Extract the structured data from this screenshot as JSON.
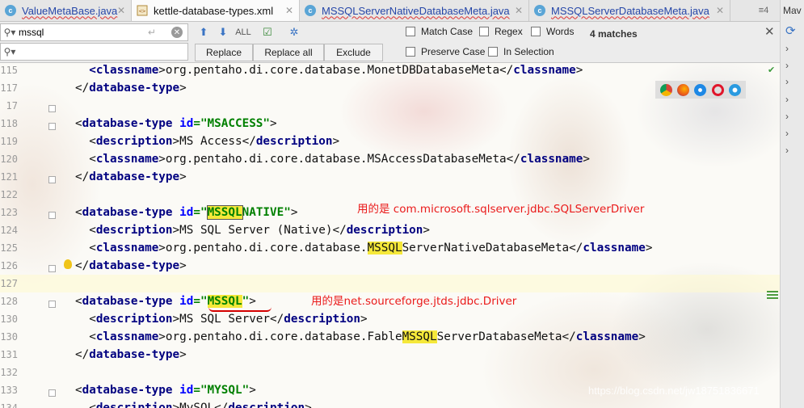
{
  "tabs": [
    {
      "label": "ValueMetaBase.java",
      "icon": "java-class-icon",
      "active": false
    },
    {
      "label": "kettle-database-types.xml",
      "icon": "xml-file-icon",
      "active": true
    },
    {
      "label": "MSSQLServerNativeDatabaseMeta.java",
      "icon": "java-class-icon",
      "active": false
    },
    {
      "label": "MSSQLServerDatabaseMeta.java",
      "icon": "java-class-icon",
      "active": false
    }
  ],
  "tab_overflow": "≡4",
  "right_panel_tab": "Mav",
  "find": {
    "search_value": "mssql",
    "replace_value": "",
    "buttons": {
      "replace": "Replace",
      "replace_all": "Replace all",
      "exclude": "Exclude"
    },
    "options": {
      "match_case": "Match Case",
      "regex": "Regex",
      "words": "Words",
      "preserve_case": "Preserve Case",
      "in_selection": "In Selection"
    },
    "matches": "4 matches"
  },
  "lines": [
    {
      "n": "115",
      "code": [
        {
          "t": "  <",
          "c": "tg"
        },
        {
          "t": "classname",
          "c": "tg"
        },
        {
          "t": ">org.pentaho.di.core.database.MonetDBDatabaseMeta</",
          "c": ""
        },
        {
          "t": "classname",
          "c": "tg"
        },
        {
          "t": ">",
          "c": ""
        }
      ]
    },
    {
      "n": "117",
      "code": [
        {
          "t": "</",
          "c": ""
        },
        {
          "t": "database-type",
          "c": "tg"
        },
        {
          "t": ">",
          "c": ""
        }
      ]
    },
    {
      "n": "17",
      "code": []
    },
    {
      "n": "118",
      "code": [
        {
          "t": "<",
          "c": ""
        },
        {
          "t": "database-type",
          "c": "tg"
        },
        {
          "t": " ",
          "c": ""
        },
        {
          "t": "id",
          "c": "at"
        },
        {
          "t": "=\"MSACCESS\"",
          "c": "av"
        },
        {
          "t": ">",
          "c": ""
        }
      ]
    },
    {
      "n": "119",
      "code": [
        {
          "t": "  <",
          "c": ""
        },
        {
          "t": "description",
          "c": "tg"
        },
        {
          "t": ">MS Access</",
          "c": ""
        },
        {
          "t": "description",
          "c": "tg"
        },
        {
          "t": ">",
          "c": ""
        }
      ]
    },
    {
      "n": "120",
      "code": [
        {
          "t": "  <",
          "c": ""
        },
        {
          "t": "classname",
          "c": "tg"
        },
        {
          "t": ">org.pentaho.di.core.database.MSAccessDatabaseMeta</",
          "c": ""
        },
        {
          "t": "classname",
          "c": "tg"
        },
        {
          "t": ">",
          "c": ""
        }
      ]
    },
    {
      "n": "121",
      "code": [
        {
          "t": "</",
          "c": ""
        },
        {
          "t": "database-type",
          "c": "tg"
        },
        {
          "t": ">",
          "c": ""
        }
      ]
    },
    {
      "n": "122",
      "code": []
    },
    {
      "n": "123",
      "code": [
        {
          "t": "<",
          "c": ""
        },
        {
          "t": "database-type",
          "c": "tg"
        },
        {
          "t": " ",
          "c": ""
        },
        {
          "t": "id",
          "c": "at"
        },
        {
          "t": "=\"",
          "c": "av"
        },
        {
          "t": "MSSQL",
          "c": "av hlb"
        },
        {
          "t": "NATIVE\"",
          "c": "av"
        },
        {
          "t": ">",
          "c": ""
        }
      ]
    },
    {
      "n": "124",
      "code": [
        {
          "t": "  <",
          "c": ""
        },
        {
          "t": "description",
          "c": "tg"
        },
        {
          "t": ">MS SQL Server (Native)</",
          "c": ""
        },
        {
          "t": "description",
          "c": "tg"
        },
        {
          "t": ">",
          "c": ""
        }
      ]
    },
    {
      "n": "125",
      "code": [
        {
          "t": "  <",
          "c": ""
        },
        {
          "t": "classname",
          "c": "tg"
        },
        {
          "t": ">org.pentaho.di.core.database.",
          "c": ""
        },
        {
          "t": "MSSQL",
          "c": "hl"
        },
        {
          "t": "ServerNativeDatabaseMeta</",
          "c": ""
        },
        {
          "t": "classname",
          "c": "tg"
        },
        {
          "t": ">",
          "c": ""
        }
      ]
    },
    {
      "n": "126",
      "code": [
        {
          "t": "</",
          "c": ""
        },
        {
          "t": "database-type",
          "c": "tg"
        },
        {
          "t": ">",
          "c": ""
        }
      ]
    },
    {
      "n": "127",
      "code": []
    },
    {
      "n": "128",
      "code": [
        {
          "t": "<",
          "c": ""
        },
        {
          "t": "database-type",
          "c": "tg"
        },
        {
          "t": " ",
          "c": ""
        },
        {
          "t": "id",
          "c": "at"
        },
        {
          "t": "=\"",
          "c": "av"
        },
        {
          "t": "MSSQL",
          "c": "av hl"
        },
        {
          "t": "\"",
          "c": "av"
        },
        {
          "t": ">",
          "c": ""
        }
      ]
    },
    {
      "n": "130",
      "code": [
        {
          "t": "  <",
          "c": ""
        },
        {
          "t": "description",
          "c": "tg"
        },
        {
          "t": ">MS SQL Server</",
          "c": ""
        },
        {
          "t": "description",
          "c": "tg"
        },
        {
          "t": ">",
          "c": ""
        }
      ]
    },
    {
      "n": "130",
      "code": [
        {
          "t": "  <",
          "c": ""
        },
        {
          "t": "classname",
          "c": "tg"
        },
        {
          "t": ">org.pentaho.di.core.database.Fable",
          "c": ""
        },
        {
          "t": "MSSQL",
          "c": "hl"
        },
        {
          "t": "ServerDatabaseMeta</",
          "c": ""
        },
        {
          "t": "classname",
          "c": "tg"
        },
        {
          "t": ">",
          "c": ""
        }
      ]
    },
    {
      "n": "131",
      "code": [
        {
          "t": "</",
          "c": ""
        },
        {
          "t": "database-type",
          "c": "tg"
        },
        {
          "t": ">",
          "c": ""
        }
      ]
    },
    {
      "n": "132",
      "code": []
    },
    {
      "n": "133",
      "code": [
        {
          "t": "<",
          "c": ""
        },
        {
          "t": "database-type",
          "c": "tg"
        },
        {
          "t": " ",
          "c": ""
        },
        {
          "t": "id",
          "c": "at"
        },
        {
          "t": "=\"MYSQL\"",
          "c": "av"
        },
        {
          "t": ">",
          "c": ""
        }
      ]
    },
    {
      "n": "134",
      "code": [
        {
          "t": "  <",
          "c": ""
        },
        {
          "t": "description",
          "c": "tg"
        },
        {
          "t": ">MySQL</",
          "c": ""
        },
        {
          "t": "description",
          "c": "tg"
        },
        {
          "t": ">",
          "c": ""
        }
      ]
    }
  ],
  "annotations": {
    "native_driver": "用的是 com.microsoft.sqlserver.jdbc.SQLServerDriver",
    "jtds_driver": "用的是net.sourceforge.jtds.jdbc.Driver"
  },
  "watermark": "https://blog.csdn.net/jw18751836671",
  "browser_icons": [
    "chrome-icon",
    "firefox-icon",
    "safari-icon",
    "opera-icon",
    "ie-icon"
  ],
  "colors": {
    "highlight": "#f5e83a",
    "annotation": "#ea1a1a",
    "tag": "#000080",
    "attr_value": "#008000"
  }
}
